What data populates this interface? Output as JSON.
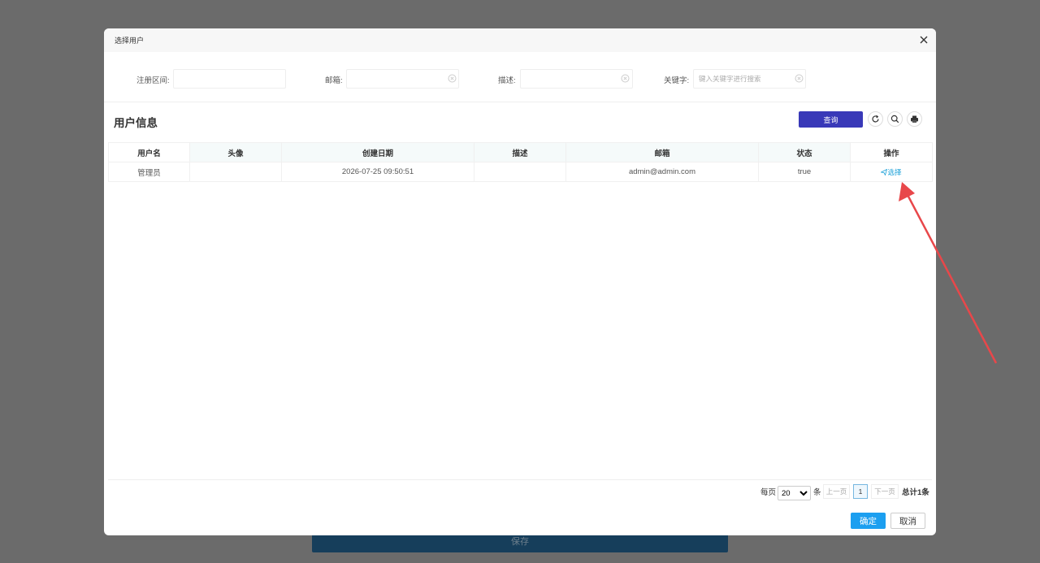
{
  "background": {
    "save_label": "保存"
  },
  "modal": {
    "title": "选择用户"
  },
  "filters": {
    "reg_range": {
      "label": "注册区间:",
      "value": "",
      "placeholder": ""
    },
    "email": {
      "label": "邮箱:",
      "value": "",
      "placeholder": ""
    },
    "desc": {
      "label": "描述:",
      "value": "",
      "placeholder": ""
    },
    "keyword": {
      "label": "关键字:",
      "value": "",
      "placeholder": "键入关键字进行搜索"
    }
  },
  "section": {
    "title": "用户信息"
  },
  "toolbar": {
    "query_label": "查询",
    "refresh_icon": "refresh-icon",
    "search_icon": "search-icon",
    "print_icon": "printer-icon"
  },
  "table": {
    "columns": [
      "用户名",
      "头像",
      "创建日期",
      "描述",
      "邮箱",
      "状态",
      "操作"
    ],
    "rows": [
      {
        "username": "管理员",
        "avatar": "",
        "created": "2026-07-25 09:50:51",
        "desc": "",
        "email": "admin@admin.com",
        "status": "true",
        "action": "选择"
      }
    ]
  },
  "pagination": {
    "per_page_label": "每页",
    "per_page_value": "20",
    "per_page_options": [
      "20"
    ],
    "unit": "条",
    "prev": "上一页",
    "current": "1",
    "next": "下一页",
    "total": "总计1条"
  },
  "footer": {
    "ok": "确定",
    "cancel": "取消"
  },
  "colors": {
    "accent": "#3939b8",
    "ok": "#1c9ff0",
    "link": "#1aa0d8",
    "annotation_arrow": "#e8474a"
  }
}
